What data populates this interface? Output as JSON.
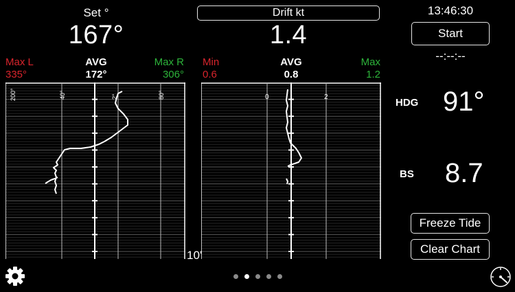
{
  "set_panel": {
    "title": "Set °",
    "value": "167°",
    "max_l_label": "Max L",
    "max_l_value": "335°",
    "avg_label": "AVG",
    "avg_value": "172°",
    "max_r_label": "Max R",
    "max_r_value": "306°",
    "ticks": [
      "200°",
      "40°",
      "2°",
      "80°"
    ]
  },
  "drift_panel": {
    "title": "Drift kt",
    "value": "1.4",
    "min_label": "Min",
    "min_value": "0.6",
    "avg_label": "AVG",
    "avg_value": "0.8",
    "max_label": "Max",
    "max_value": "1.2",
    "ticks": [
      "0",
      "2"
    ]
  },
  "time_scale_label": "10'",
  "right_panel": {
    "clock": "13:46:30",
    "start_label": "Start",
    "timer": "--:--:--",
    "hdg_label": "HDG",
    "hdg_value": "91°",
    "bs_label": "BS",
    "bs_value": "8.7",
    "freeze_label": "Freeze Tide",
    "clear_label": "Clear Chart"
  },
  "page_indicator": {
    "count": 5,
    "active_index": 1
  },
  "icons": {
    "settings": "gear-icon",
    "gauge": "gauge-icon"
  },
  "colors": {
    "red": "#d8242c",
    "green": "#2db33a",
    "background": "#000000"
  }
}
